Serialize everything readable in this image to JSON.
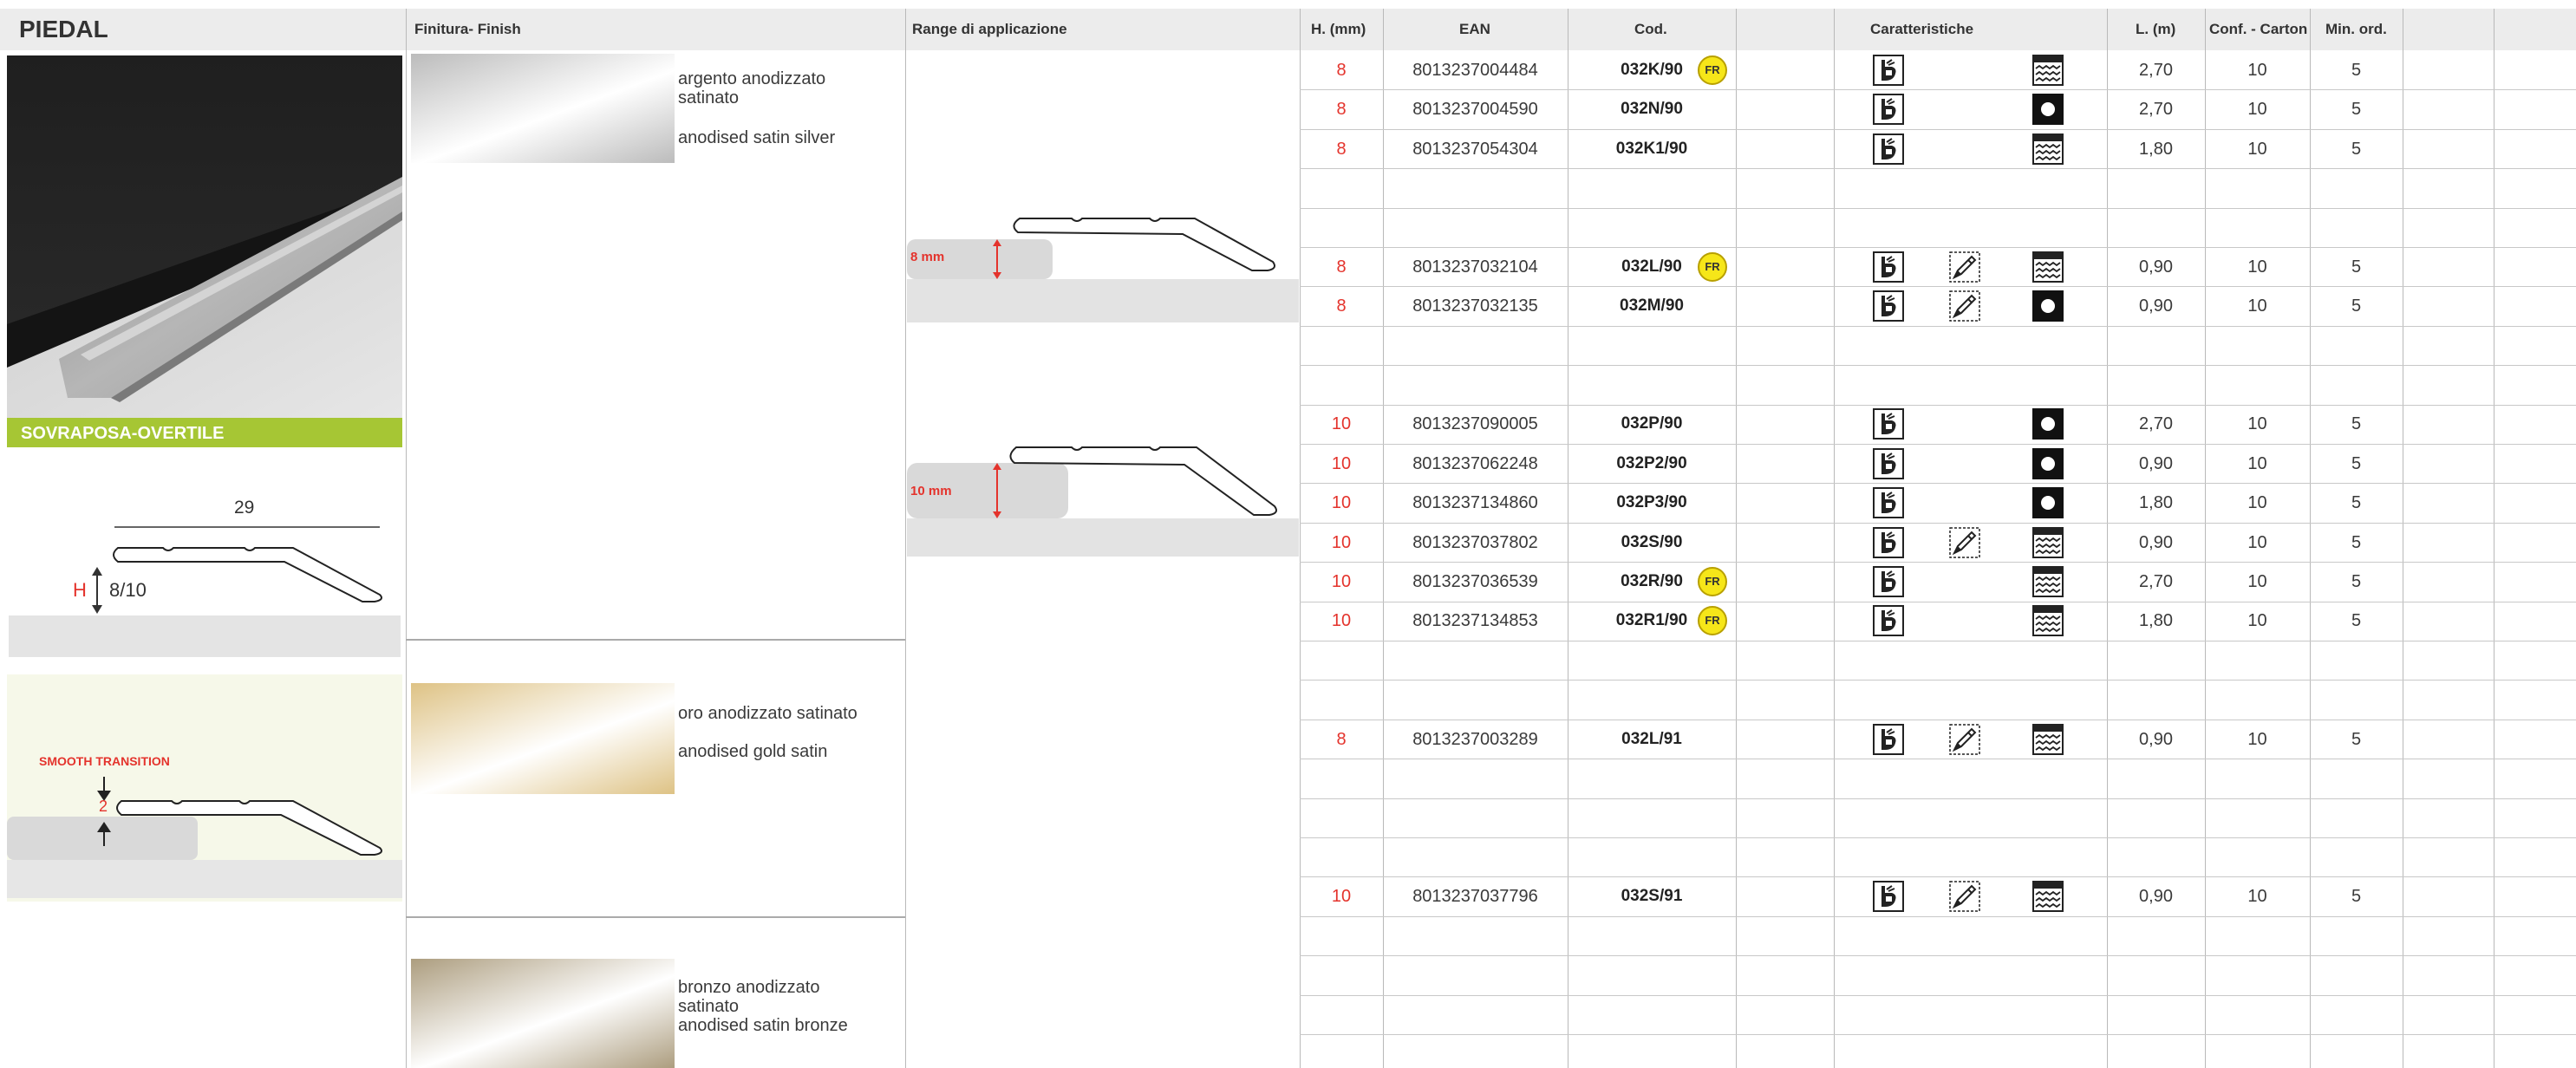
{
  "product": {
    "title": "PIEDAL",
    "badge": "SOVRAPOSA-OVERTILE",
    "dim_width": "29",
    "dim_h_letter": "H",
    "dim_h_value": "8/10",
    "smooth_label": "SMOOTH TRANSITION",
    "smooth_value": "2"
  },
  "headers": {
    "finish": "Finitura- Finish",
    "range": "Range di applicazione",
    "h": "H. (mm)",
    "ean": "EAN",
    "cod": "Cod.",
    "features": "Caratteristiche",
    "length": "L. (m)",
    "carton": "Conf. - Carton",
    "min_order": "Min. ord."
  },
  "finishes": [
    {
      "it": "argento anodizzato satinato",
      "en": "anodised satin silver",
      "color": "#b8b8b8"
    },
    {
      "it": "oro anodizzato satinato",
      "en": "anodised gold satin",
      "color": "#dcbf7e"
    },
    {
      "it": "bronzo anodizzato satinato",
      "en": "anodised satin bronze",
      "color": "#a89878"
    }
  ],
  "range_labels": [
    "8 mm",
    "10 mm"
  ],
  "fr_label": "FR",
  "rows": [
    {
      "h": "8",
      "ean": "8013237004484",
      "cod": "032K/90",
      "fr": true,
      "features": [
        "hand-saw-icon",
        "",
        "wavy-icon"
      ],
      "length": "2,70",
      "carton": "10",
      "min": "5"
    },
    {
      "h": "8",
      "ean": "8013237004590",
      "cod": "032N/90",
      "fr": false,
      "features": [
        "hand-saw-icon",
        "",
        "dot-icon"
      ],
      "length": "2,70",
      "carton": "10",
      "min": "5"
    },
    {
      "h": "8",
      "ean": "8013237054304",
      "cod": "032K1/90",
      "fr": false,
      "features": [
        "hand-saw-icon",
        "",
        "wavy-icon"
      ],
      "length": "1,80",
      "carton": "10",
      "min": "5"
    },
    null,
    null,
    {
      "h": "8",
      "ean": "8013237032104",
      "cod": "032L/90",
      "fr": true,
      "features": [
        "hand-saw-icon",
        "pencil-icon",
        "wavy-icon"
      ],
      "length": "0,90",
      "carton": "10",
      "min": "5"
    },
    {
      "h": "8",
      "ean": "8013237032135",
      "cod": "032M/90",
      "fr": false,
      "features": [
        "hand-saw-icon",
        "pencil-icon",
        "dot-icon"
      ],
      "length": "0,90",
      "carton": "10",
      "min": "5"
    },
    null,
    null,
    {
      "h": "10",
      "ean": "8013237090005",
      "cod": "032P/90",
      "fr": false,
      "features": [
        "hand-saw-icon",
        "",
        "dot-icon"
      ],
      "length": "2,70",
      "carton": "10",
      "min": "5"
    },
    {
      "h": "10",
      "ean": "8013237062248",
      "cod": "032P2/90",
      "fr": false,
      "features": [
        "hand-saw-icon",
        "",
        "dot-icon"
      ],
      "length": "0,90",
      "carton": "10",
      "min": "5"
    },
    {
      "h": "10",
      "ean": "8013237134860",
      "cod": "032P3/90",
      "fr": false,
      "features": [
        "hand-saw-icon",
        "",
        "dot-icon"
      ],
      "length": "1,80",
      "carton": "10",
      "min": "5"
    },
    {
      "h": "10",
      "ean": "8013237037802",
      "cod": "032S/90",
      "fr": false,
      "features": [
        "hand-saw-icon",
        "pencil-icon",
        "wavy-icon"
      ],
      "length": "0,90",
      "carton": "10",
      "min": "5"
    },
    {
      "h": "10",
      "ean": "8013237036539",
      "cod": "032R/90",
      "fr": true,
      "features": [
        "hand-saw-icon",
        "",
        "wavy-icon"
      ],
      "length": "2,70",
      "carton": "10",
      "min": "5"
    },
    {
      "h": "10",
      "ean": "8013237134853",
      "cod": "032R1/90",
      "fr": true,
      "features": [
        "hand-saw-icon",
        "",
        "wavy-icon"
      ],
      "length": "1,80",
      "carton": "10",
      "min": "5"
    },
    null,
    null,
    {
      "h": "8",
      "ean": "8013237003289",
      "cod": "032L/91",
      "fr": false,
      "features": [
        "hand-saw-icon",
        "pencil-icon",
        "wavy-icon"
      ],
      "length": "0,90",
      "carton": "10",
      "min": "5"
    },
    null,
    null,
    null,
    {
      "h": "10",
      "ean": "8013237037796",
      "cod": "032S/91",
      "fr": false,
      "features": [
        "hand-saw-icon",
        "pencil-icon",
        "wavy-icon"
      ],
      "length": "0,90",
      "carton": "10",
      "min": "5"
    },
    null,
    null,
    null,
    null
  ]
}
